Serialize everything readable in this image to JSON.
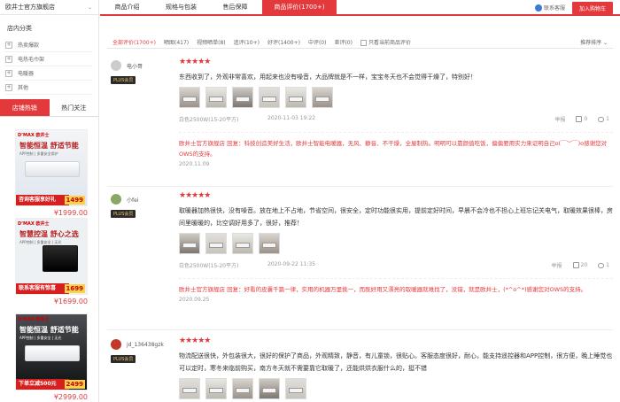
{
  "shop": {
    "name": "欧井士官方旗舰店",
    "chevron": "⌄"
  },
  "category": {
    "title": "店内分类",
    "items": [
      "热卖爆款",
      "电热毛巾架",
      "电暖器",
      "其他"
    ]
  },
  "side_tabs": [
    "店铺热销",
    "热门关注"
  ],
  "products": [
    {
      "brand": "D’MAX 欧井士",
      "headline": "智能恒温 舒适节能",
      "sub": "APP控制 | 多重安全保护",
      "banner": "咨询客服享好礼",
      "tag_price": "1499",
      "price": "¥1999.00"
    },
    {
      "brand": "D’MAX 欧井士",
      "headline": "智慧控温 舒心之选",
      "sub": "APP控制 | 多重安全 | 无光",
      "banner": "联系客服有惊喜",
      "tag_price": "1699",
      "price": "¥1699.00"
    },
    {
      "brand": "D’MAX 欧井士",
      "headline": "智能恒温 舒适节能",
      "sub": "APP控制 | 多重安全 | 无光",
      "banner": "下单立减500元",
      "tag_price": "2499",
      "price": "¥2999.00"
    }
  ],
  "tabs": [
    "商品介绍",
    "规格与包装",
    "售后保障",
    "商品评价(1700+)"
  ],
  "contact": "联系客服",
  "cart_button": "加入购物车",
  "filters": {
    "items": [
      "全部评价(1700+)",
      "晒图(417)",
      "视频晒单(8)",
      "追评(10+)",
      "好评(1400+)",
      "中评(0)",
      "差评(0)"
    ],
    "only_current": "只看当前商品评价",
    "sort": "推荐排序 ⌄"
  },
  "reviews": [
    {
      "user": "电小哥",
      "badge": "PLUS会员",
      "stars": "★★★★★",
      "text": "东西收到了，外观非常喜欢，用起来也没有噪音，大品牌就是不一样，宝宝冬天也不会觉得干燥了，特别好！",
      "spec": "白色2500W(15-20平方)",
      "date": "2020-11-03 19:22",
      "report": "举报",
      "likes": "0",
      "comments": "1",
      "reply": "欧井士官方旗舰店 回复：科技创造美好生活，欧井士智能电暖器，无风、静音、不干燥，全屋制热。明明可以靠颜值吃饭，偏偏要用实力来证明自己o(￣︶￣)o感谢您对OWS的支持。",
      "reply_date": "2020.11.09"
    },
    {
      "user": "小fei",
      "badge": "PLUS会员",
      "stars": "★★★★★",
      "text": "取暖器加热很快，没有噪音。放在地上不占地，节省空间，很安全，定时功能很实用，提前定好时间，早晨不会冷也不担心上班忘记关电气，取暖效果很棒，房间里暖暖的，比空调好用多了，很好，推荐！",
      "spec": "白色2500W(15-20平方)",
      "date": "2020-09-22 11:35",
      "report": "举报",
      "likes": "20",
      "comments": "1",
      "reply": "欧井士官方旗舰店 回复：好看的皮囊千篇一律，实用的机器万里挑一，而既好用又漂亮的取暖器就难找了，没错，就是欧井士，(*^o^*)感谢您对OWS的支持。",
      "reply_date": "2020.09.25"
    },
    {
      "user": "jd_136438gzk",
      "badge": "PLUS会员",
      "stars": "★★★★★",
      "text": "物流配送很快，外包装很大，很好的保护了商品，外观精致，静音，有儿童锁，很贴心。客服态度很好，耐心，能支持遥控器和APP控制，很方便，晚上睡觉也可以定时，寒冬来临前购买，南方冬天就不需要靠它取暖了，还能烘烘衣服什么的，挺不错"
    }
  ]
}
